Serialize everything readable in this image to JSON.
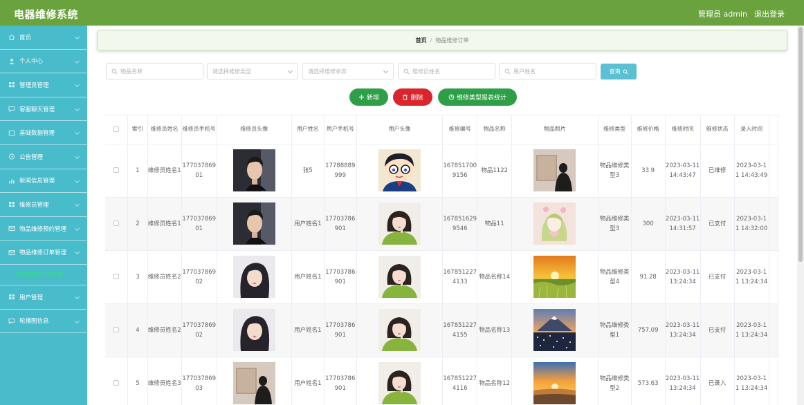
{
  "header": {
    "title": "电器维修系统",
    "admin": "管理员 admin",
    "logout": "退出登录"
  },
  "sidebar": {
    "items": [
      {
        "label": "首页",
        "icon": "home-icon"
      },
      {
        "label": "个人中心",
        "icon": "user-icon"
      },
      {
        "label": "管理员管理",
        "icon": "grid-icon"
      },
      {
        "label": "客服聊天管理",
        "icon": "chat-icon"
      },
      {
        "label": "基础数据管理",
        "icon": "box-icon"
      },
      {
        "label": "公告管理",
        "icon": "bell-icon"
      },
      {
        "label": "新闻信息管理",
        "icon": "chart-icon"
      },
      {
        "label": "维修员管理",
        "icon": "grid-icon"
      },
      {
        "label": "物品维修预约管理",
        "icon": "mail-icon"
      },
      {
        "label": "物品维修订单管理",
        "icon": "mail-icon"
      }
    ],
    "sub_active": "物品维修订单管理",
    "items_after": [
      {
        "label": "用户管理",
        "icon": "grid-icon"
      },
      {
        "label": "轮播图信息",
        "icon": "chat-icon"
      }
    ]
  },
  "breadcrumb": {
    "home": "首页",
    "sep": "/",
    "current": "物品维修订单"
  },
  "search": {
    "item_name": "物品名称",
    "repair_type": "请选择维修类型",
    "repair_status": "请选择维修状态",
    "repairer_name": "维修员姓名",
    "user_name": "用户姓名",
    "query_button": "查询"
  },
  "actions": {
    "add": "新增",
    "delete": "删除",
    "stats": "维修类型报表统计"
  },
  "table": {
    "columns": [
      "索引",
      "维修员姓名",
      "维修员手机号",
      "维修员头像",
      "用户姓名",
      "用户手机号",
      "用户头像",
      "维修编号",
      "物品名称",
      "物品照片",
      "维修类型",
      "维修价格",
      "维修时间",
      "维修状态",
      "录入时间"
    ],
    "rows": [
      {
        "index": "1",
        "repairer_name": "维修员姓名1",
        "repairer_phone": "17703786901",
        "repairer_avatar": "man-photo",
        "user_name": "张5",
        "user_phone": "17788889999",
        "user_avatar": "cartoon-boy-photo",
        "order_no": "1678517009156",
        "item_name": "物品1122",
        "item_photo": "man-back-photo",
        "type": "物品维修类型3",
        "price": "33.9",
        "repair_time": "2023-03-11 14:43:47",
        "status": "已维修",
        "entry_time": "2023-03-11 14:43:49"
      },
      {
        "index": "2",
        "repairer_name": "维修员姓名1",
        "repairer_phone": "17703786901",
        "repairer_avatar": "man-photo",
        "user_name": "用户姓名1",
        "user_phone": "17703786901",
        "user_avatar": "girl-green-photo",
        "order_no": "1678516299546",
        "item_name": "物品11",
        "item_photo": "anime-girl-photo",
        "type": "物品维修类型3",
        "price": "300",
        "repair_time": "2023-03-11 14:31:57",
        "status": "已支付",
        "entry_time": "2023-03-11 14:32:00"
      },
      {
        "index": "3",
        "repairer_name": "维修员姓名2",
        "repairer_phone": "17703786902",
        "repairer_avatar": "woman-photo",
        "user_name": "用户姓名1",
        "user_phone": "17703786901",
        "user_avatar": "girl-green-photo",
        "order_no": "1678512274133",
        "item_name": "物品名称14",
        "item_photo": "sunset-field-photo",
        "type": "物品维修类型4",
        "price": "91.28",
        "repair_time": "2023-03-11 13:24:34",
        "status": "已支付",
        "entry_time": "2023-03-11 13:24:34"
      },
      {
        "index": "4",
        "repairer_name": "维修员姓名2",
        "repairer_phone": "17703786902",
        "repairer_avatar": "woman-photo",
        "user_name": "用户姓名1",
        "user_phone": "17703786901",
        "user_avatar": "girl-green-photo",
        "order_no": "1678512274155",
        "item_name": "物品名称13",
        "item_photo": "city-mountain-photo",
        "type": "物品维修类型1",
        "price": "757.09",
        "repair_time": "2023-03-11 13:24:34",
        "status": "已支付",
        "entry_time": "2023-03-11 13:24:34"
      },
      {
        "index": "5",
        "repairer_name": "维修员姓名3",
        "repairer_phone": "17703786903",
        "repairer_avatar": "man-back-photo",
        "user_name": "用户姓名1",
        "user_phone": "17703786901",
        "user_avatar": "girl-green-photo",
        "order_no": "1678512274116",
        "item_name": "物品名称12",
        "item_photo": "sunset-sea-photo",
        "type": "物品维修类型2",
        "price": "573.63",
        "repair_time": "2023-03-11 13:24:34",
        "status": "已录入",
        "entry_time": "2023-03-11 13:24:34"
      }
    ]
  },
  "colors": {
    "topbar": "#6aa23d",
    "sidebar": "#49bccc",
    "active_sub": "#30e07a",
    "add_button": "#2e9f47",
    "delete_button": "#d9262c",
    "query_button": "#5bc0d1"
  }
}
